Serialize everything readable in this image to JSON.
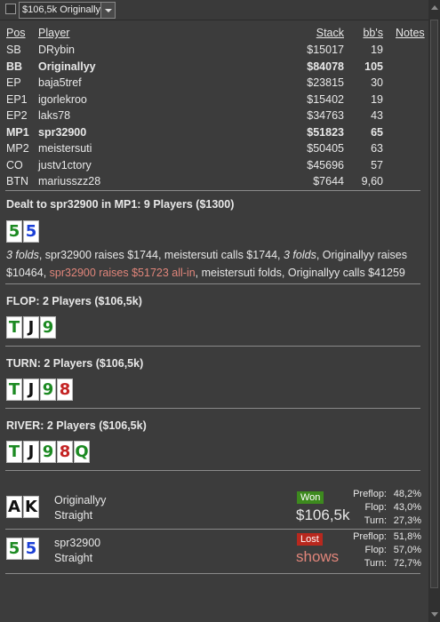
{
  "toolbar": {
    "filter_value": "$106,5k Originallyy"
  },
  "table": {
    "headers": {
      "pos": "Pos",
      "player": "Player",
      "stack": "Stack",
      "bb": "bb's",
      "notes": "Notes"
    },
    "rows": [
      {
        "pos": "SB",
        "player": "DRybin",
        "stack": "$15017",
        "bb": "19",
        "bold": false
      },
      {
        "pos": "BB",
        "player": "Originallyy",
        "stack": "$84078",
        "bb": "105",
        "bold": true
      },
      {
        "pos": "EP",
        "player": "baja5tref",
        "stack": "$23815",
        "bb": "30",
        "bold": false
      },
      {
        "pos": "EP1",
        "player": "igorlekroo",
        "stack": "$15402",
        "bb": "19",
        "bold": false
      },
      {
        "pos": "EP2",
        "player": "laks78",
        "stack": "$34763",
        "bb": "43",
        "bold": false
      },
      {
        "pos": "MP1",
        "player": "spr32900",
        "stack": "$51823",
        "bb": "65",
        "bold": true
      },
      {
        "pos": "MP2",
        "player": "meistersuti",
        "stack": "$50405",
        "bb": "63",
        "bold": false
      },
      {
        "pos": "CO",
        "player": "justv1ctory",
        "stack": "$45696",
        "bb": "57",
        "bold": false
      },
      {
        "pos": "BTN",
        "player": "mariusszz28",
        "stack": "$7644",
        "bb": "9,60",
        "bold": false
      }
    ]
  },
  "preflop": {
    "title": "Dealt to spr32900 in MP1: 9 Players ($1300)",
    "cards": [
      {
        "rank": "5",
        "suit": "club"
      },
      {
        "rank": "5",
        "suit": "diamond"
      }
    ],
    "actions": {
      "a1": "3 folds",
      "a2": ", spr32900 raises $1744, meistersuti calls $1744, ",
      "a3": "3 folds",
      "a4": ", Originallyy raises $10464, ",
      "a5": "spr32900 raises $51723 all-in",
      "a6": ", meistersuti folds, Originallyy calls $41259"
    }
  },
  "flop": {
    "title": "FLOP: 2 Players ($106,5k)",
    "cards": [
      {
        "rank": "T",
        "suit": "club"
      },
      {
        "rank": "J",
        "suit": "spade"
      },
      {
        "rank": "9",
        "suit": "club"
      }
    ]
  },
  "turn": {
    "title": "TURN: 2 Players ($106,5k)",
    "cards": [
      {
        "rank": "T",
        "suit": "club"
      },
      {
        "rank": "J",
        "suit": "spade"
      },
      {
        "rank": "9",
        "suit": "club"
      },
      {
        "rank": "8",
        "suit": "heart"
      }
    ]
  },
  "river": {
    "title": "RIVER: 2 Players ($106,5k)",
    "cards": [
      {
        "rank": "T",
        "suit": "club"
      },
      {
        "rank": "J",
        "suit": "spade"
      },
      {
        "rank": "9",
        "suit": "club"
      },
      {
        "rank": "8",
        "suit": "heart"
      },
      {
        "rank": "Q",
        "suit": "club"
      }
    ]
  },
  "results": [
    {
      "player": "Originallyy",
      "hand": "Straight",
      "status": "Won",
      "amount": "$106,5k",
      "cards": [
        {
          "rank": "A",
          "suit": "spade"
        },
        {
          "rank": "K",
          "suit": "spade"
        }
      ],
      "equity": [
        {
          "label": "Preflop:",
          "value": "48,2%"
        },
        {
          "label": "Flop:",
          "value": "43,0%"
        },
        {
          "label": "Turn:",
          "value": "27,3%"
        }
      ]
    },
    {
      "player": "spr32900",
      "hand": "Straight",
      "status": "Lost",
      "amount": "shows",
      "cards": [
        {
          "rank": "5",
          "suit": "club"
        },
        {
          "rank": "5",
          "suit": "diamond"
        }
      ],
      "equity": [
        {
          "label": "Preflop:",
          "value": "51,8%"
        },
        {
          "label": "Flop:",
          "value": "57,0%"
        },
        {
          "label": "Turn:",
          "value": "72,7%"
        }
      ]
    }
  ],
  "colors": {
    "background": "#3c3c3c",
    "club": "#1c8a22",
    "diamond": "#1b3fd6",
    "spade": "#111111",
    "heart": "#c42424",
    "won_badge": "#3d8a1e",
    "lost_badge": "#b8281e",
    "highlight_action": "#e0857a"
  }
}
